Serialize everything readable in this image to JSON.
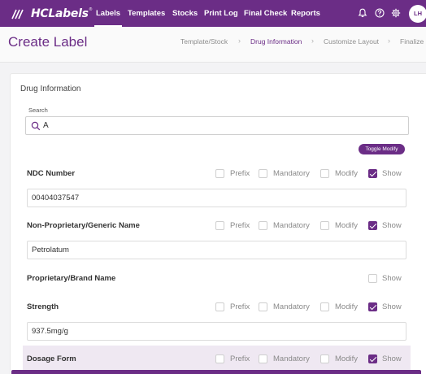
{
  "app": {
    "logo_text": "HCLabels",
    "logo_tm": "®",
    "user_initials": "LH"
  },
  "nav": {
    "items": [
      {
        "label": "Labels",
        "active": true
      },
      {
        "label": "Templates"
      },
      {
        "label": "Stocks"
      },
      {
        "label": "Print Log"
      },
      {
        "label": "Final Check"
      },
      {
        "label": "Reports"
      }
    ],
    "icons": [
      "bell-icon",
      "help-icon",
      "gear-icon"
    ]
  },
  "page": {
    "title": "Create Label",
    "steps": [
      {
        "label": "Template/Stock"
      },
      {
        "label": "Drug Information",
        "active": true
      },
      {
        "label": "Customize Layout"
      },
      {
        "label": "Finalize"
      }
    ]
  },
  "drug_info": {
    "section_title": "Drug Information",
    "search_label": "Search",
    "search_value": "A",
    "toggle_button": "Toggle Modify",
    "option_labels": {
      "prefix": "Prefix",
      "mandatory": "Mandatory",
      "modify": "Modify",
      "show": "Show"
    },
    "fields": [
      {
        "label": "NDC Number",
        "value": "00404037547",
        "prefix": false,
        "mandatory": false,
        "modify": false,
        "show": true
      },
      {
        "label": "Non-Proprietary/Generic Name",
        "value": "Petrolatum",
        "prefix": false,
        "mandatory": false,
        "modify": false,
        "show": true
      },
      {
        "label": "Proprietary/Brand Name",
        "show": false
      },
      {
        "label": "Strength",
        "value": "937.5mg/g",
        "prefix": false,
        "mandatory": false,
        "modify": false,
        "show": true
      },
      {
        "label": "Dosage Form",
        "prefix": false,
        "mandatory": false,
        "modify": false,
        "show": true
      }
    ]
  },
  "colors": {
    "brand": "#6b2d86",
    "highlight_row": "#efe8f2"
  }
}
